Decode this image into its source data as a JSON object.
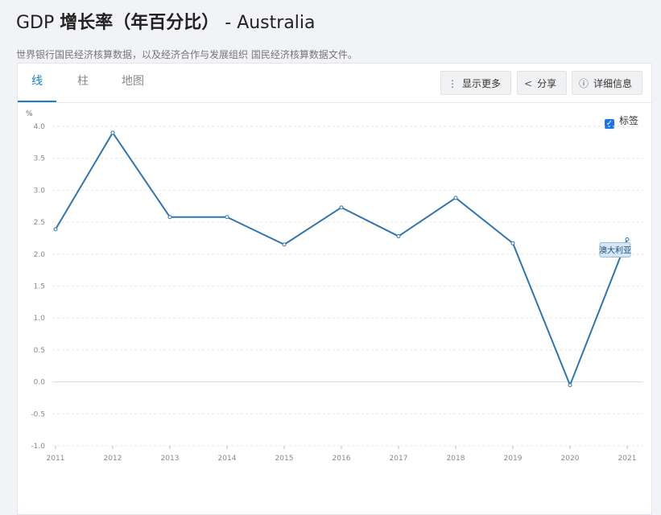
{
  "header": {
    "title_prefix": "GDP ",
    "title_cn": "增长率（年百分比）",
    "title_suffix": " - Australia",
    "subtitle": "世界银行国民经济核算数据，以及经济合作与发展组织 国民经济核算数据文件。"
  },
  "tabs": [
    {
      "label": "线",
      "active": true
    },
    {
      "label": "柱",
      "active": false
    },
    {
      "label": "地图",
      "active": false
    }
  ],
  "toolbar": {
    "more_label": "显示更多",
    "share_label": "分享",
    "details_label": "详细信息",
    "more_icon": "more-vertical-icon",
    "share_icon": "share-icon",
    "details_icon": "info-icon"
  },
  "label_toggle": {
    "label": "标签",
    "checked": true
  },
  "colors": {
    "accent": "#1a7fc4",
    "line": "#2f75b0",
    "label_bg": "#d6e6f5"
  },
  "chart_data": {
    "type": "line",
    "ylabel": "%",
    "ylim": [
      -1.0,
      4.0
    ],
    "y_ticks": [
      "4.0",
      "3.5",
      "3.0",
      "2.5",
      "2.0",
      "1.5",
      "1.0",
      "0.5",
      "0.0",
      "-0.5",
      "-1.0"
    ],
    "x": [
      "2011",
      "2012",
      "2013",
      "2014",
      "2015",
      "2016",
      "2017",
      "2018",
      "2019",
      "2020",
      "2021"
    ],
    "series": [
      {
        "name": "澳大利亚",
        "values": [
          2.39,
          3.9,
          2.58,
          2.58,
          2.15,
          2.73,
          2.28,
          2.88,
          2.17,
          -0.05,
          2.23
        ]
      }
    ],
    "grid": true
  }
}
